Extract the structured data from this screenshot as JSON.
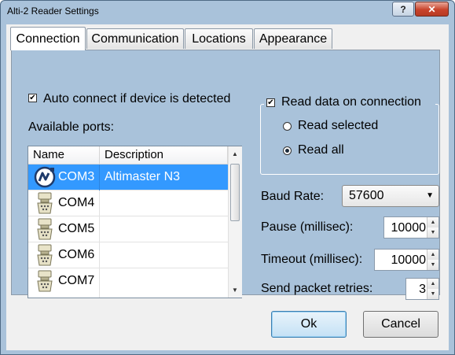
{
  "window": {
    "title": "Alti-2 Reader Settings",
    "help_label": "?",
    "close_label": "✕"
  },
  "tabs": [
    {
      "label": "Connection",
      "active": true
    },
    {
      "label": "Communication",
      "active": false
    },
    {
      "label": "Locations",
      "active": false
    },
    {
      "label": "Appearance",
      "active": false
    }
  ],
  "connection": {
    "auto_connect": {
      "label": "Auto connect if device is detected",
      "checked": true
    },
    "available_ports_label": "Available ports:",
    "ports_table": {
      "columns": [
        "Name",
        "Description"
      ],
      "rows": [
        {
          "name": "COM3",
          "description": "Altimaster N3",
          "selected": true,
          "icon": "altimaster-device-icon"
        },
        {
          "name": "COM4",
          "description": "",
          "selected": false,
          "icon": "serial-port-icon"
        },
        {
          "name": "COM5",
          "description": "",
          "selected": false,
          "icon": "serial-port-icon"
        },
        {
          "name": "COM6",
          "description": "",
          "selected": false,
          "icon": "serial-port-icon"
        },
        {
          "name": "COM7",
          "description": "",
          "selected": false,
          "icon": "serial-port-icon"
        }
      ]
    },
    "read_on_connection": {
      "label": "Read data on connection",
      "checked": true,
      "options": [
        {
          "label": "Read selected",
          "selected": false
        },
        {
          "label": "Read all",
          "selected": true
        }
      ]
    },
    "baud_rate": {
      "label": "Baud Rate:",
      "value": "57600"
    },
    "pause": {
      "label": "Pause (millisec):",
      "value": "10000"
    },
    "timeout": {
      "label": "Timeout (millisec):",
      "value": "10000"
    },
    "retries": {
      "label": "Send packet retries:",
      "value": "3"
    }
  },
  "buttons": {
    "ok": "Ok",
    "cancel": "Cancel"
  },
  "colors": {
    "accent": "#3399ff",
    "panel": "#a9c2da",
    "close": "#c8432b"
  }
}
